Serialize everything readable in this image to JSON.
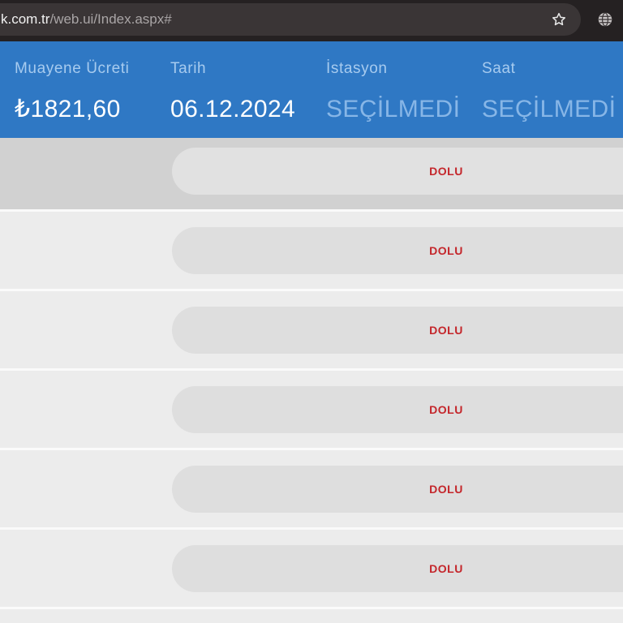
{
  "browser": {
    "url_host": "k.com.tr",
    "url_path": "/web.ui/Index.aspx#",
    "icons": [
      "star-icon",
      "globe-icon"
    ]
  },
  "summary": {
    "fields": [
      {
        "label": "Muayene Ücreti",
        "value": "₺1821,60"
      },
      {
        "label": "Tarih",
        "value": "06.12.2024"
      },
      {
        "label": "İstasyon",
        "value": "SEÇİLMEDİ"
      },
      {
        "label": "Saat",
        "value": "SEÇİLMEDİ"
      }
    ]
  },
  "slots": [
    {
      "status": "DOLU"
    },
    {
      "status": "DOLU"
    },
    {
      "status": "DOLU"
    },
    {
      "status": "DOLU"
    },
    {
      "status": "DOLU"
    },
    {
      "status": "DOLU"
    }
  ],
  "colors": {
    "toolbar_bg": "#252122",
    "omnibox_bg": "#3a3536",
    "url_host": "#f2f2f2",
    "url_path": "#a9a5a6",
    "icon_fg": "#e8e8e8",
    "header_bg": "#2f78c4",
    "header_label": "#a7cbef",
    "header_value": "#ffffff",
    "header_value_unset": "#87b6e7",
    "row_bg": "#ececec",
    "row_active_bg": "#d1d1d1",
    "slot_pill_bg": "#dedede",
    "slot_pill_active_bg": "#e1e1e1",
    "separator": "#fafafa",
    "status_full": "#c4262b"
  }
}
